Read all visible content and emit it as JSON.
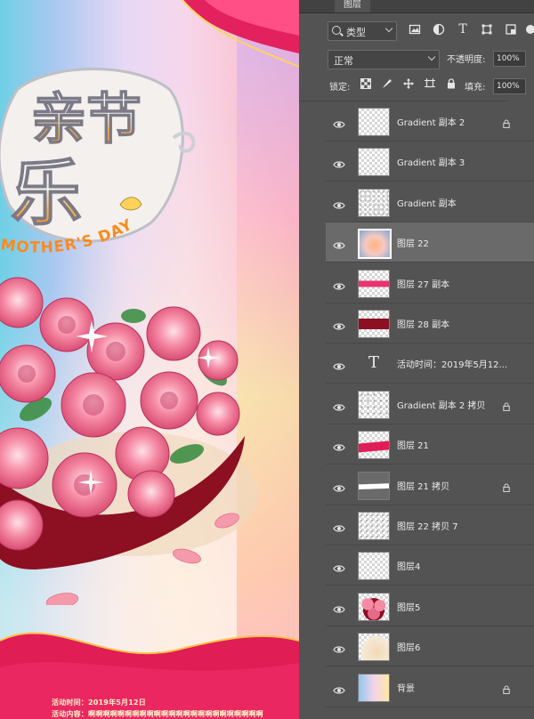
{
  "canvas": {
    "title_big": "亲节",
    "mothers_day_text": "MOTHER'S DAY",
    "event_time": "活动时间：2019年5月12日",
    "event_content": "活动内容：啊啊啊啊啊啊啊啊啊啊啊啊啊啊啊啊啊啊啊啊啊啊啊啊"
  },
  "panel": {
    "tab_label": "图层",
    "filter": {
      "kind_label": "类型",
      "icons": [
        "image-filter-icon",
        "adjustment-filter-icon",
        "text-filter-icon",
        "shape-filter-icon",
        "smart-object-filter-icon"
      ]
    },
    "blend": {
      "mode": "正常",
      "opacity_label": "不透明度:",
      "opacity_value": "100%"
    },
    "lock": {
      "label": "锁定:",
      "fill_label": "填充:",
      "fill_value": "100%"
    },
    "layers": [
      {
        "name": "Gradient 副本 2",
        "thumb": "checker-light",
        "locked": true,
        "selected": false
      },
      {
        "name": "Gradient 副本 3",
        "thumb": "checker-plain",
        "locked": false,
        "selected": false
      },
      {
        "name": "Gradient 副本",
        "thumb": "checker-texture",
        "locked": false,
        "selected": false
      },
      {
        "name": "图层 22",
        "thumb": "title-art",
        "locked": false,
        "selected": true
      },
      {
        "name": "图层 27 副本",
        "thumb": "pink-stripe",
        "locked": false,
        "selected": false
      },
      {
        "name": "图层 28 副本",
        "thumb": "red-band",
        "locked": false,
        "selected": false
      },
      {
        "name": "活动时间：2019年5月12...",
        "thumb": "text",
        "locked": false,
        "selected": false
      },
      {
        "name": "Gradient 副本 2 拷贝",
        "thumb": "checker-sparse",
        "locked": true,
        "selected": false
      },
      {
        "name": "图层 21",
        "thumb": "red-wave",
        "locked": false,
        "selected": false
      },
      {
        "name": "图层 21 拷贝",
        "thumb": "white-wave",
        "locked": true,
        "selected": false
      },
      {
        "name": "图层 22 拷贝 7",
        "thumb": "checker-dots",
        "locked": false,
        "selected": false
      },
      {
        "name": "图层4",
        "thumb": "checker-plain",
        "locked": false,
        "selected": false
      },
      {
        "name": "图层5",
        "thumb": "roses",
        "locked": false,
        "selected": false
      },
      {
        "name": "图层6",
        "thumb": "beige",
        "locked": false,
        "selected": false
      },
      {
        "name": "背景",
        "thumb": "gradient-bg",
        "locked": true,
        "selected": false
      }
    ]
  },
  "colors": {
    "panel_bg": "#535353",
    "selected_row": "#6a6a6a",
    "accent_pink": "#e8336f"
  }
}
